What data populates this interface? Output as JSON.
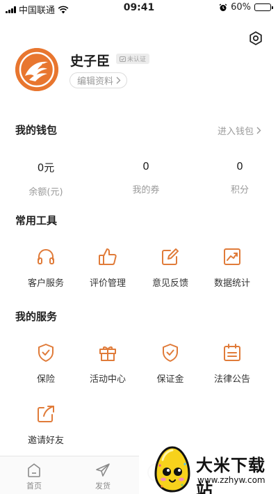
{
  "status_bar": {
    "carrier": "中国联通",
    "time": "09:41",
    "battery_percent": "60%",
    "battery_level": 0.6
  },
  "profile": {
    "name": "史子臣",
    "verify_badge": "未认证",
    "edit_label": "编辑资料"
  },
  "wallet": {
    "title": "我的钱包",
    "enter_label": "进入钱包",
    "stats": [
      {
        "value": "0元",
        "label": "余额(元)"
      },
      {
        "value": "0",
        "label": "我的券"
      },
      {
        "value": "0",
        "label": "积分"
      }
    ]
  },
  "tools": {
    "title": "常用工具",
    "items": [
      {
        "label": "客户服务",
        "icon": "headset-icon"
      },
      {
        "label": "评价管理",
        "icon": "thumbs-up-icon"
      },
      {
        "label": "意见反馈",
        "icon": "edit-icon"
      },
      {
        "label": "数据统计",
        "icon": "chart-icon"
      }
    ]
  },
  "services": {
    "title": "我的服务",
    "items": [
      {
        "label": "保险",
        "icon": "shield-check-icon"
      },
      {
        "label": "活动中心",
        "icon": "gift-icon"
      },
      {
        "label": "保证金",
        "icon": "shield-check-icon"
      },
      {
        "label": "法律公告",
        "icon": "calendar-list-icon"
      },
      {
        "label": "邀请好友",
        "icon": "share-icon"
      }
    ]
  },
  "tab_bar": {
    "items": [
      {
        "label": "首页",
        "icon": "home-icon"
      },
      {
        "label": "发货",
        "icon": "send-icon"
      }
    ]
  },
  "watermark": {
    "title": "大米下载站",
    "url": "www.zzhyw.com"
  },
  "colors": {
    "accent": "#e07b39",
    "muted": "#9a9a9a"
  }
}
